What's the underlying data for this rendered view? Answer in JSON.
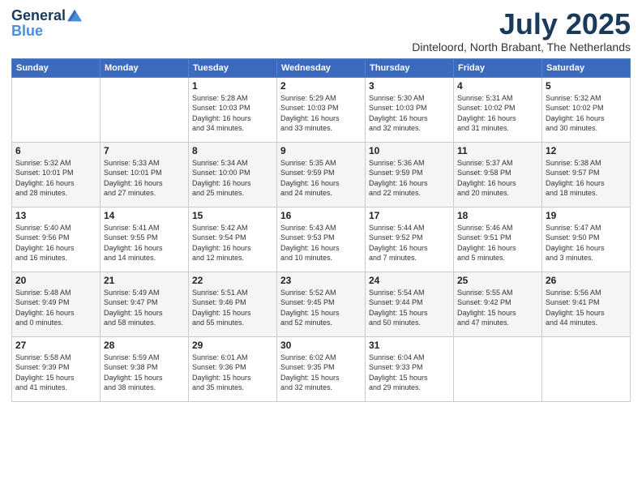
{
  "logo": {
    "line1": "General",
    "line2": "Blue"
  },
  "title": "July 2025",
  "subtitle": "Dinteloord, North Brabant, The Netherlands",
  "days_header": [
    "Sunday",
    "Monday",
    "Tuesday",
    "Wednesday",
    "Thursday",
    "Friday",
    "Saturday"
  ],
  "weeks": [
    [
      {
        "num": "",
        "info": ""
      },
      {
        "num": "",
        "info": ""
      },
      {
        "num": "1",
        "info": "Sunrise: 5:28 AM\nSunset: 10:03 PM\nDaylight: 16 hours\nand 34 minutes."
      },
      {
        "num": "2",
        "info": "Sunrise: 5:29 AM\nSunset: 10:03 PM\nDaylight: 16 hours\nand 33 minutes."
      },
      {
        "num": "3",
        "info": "Sunrise: 5:30 AM\nSunset: 10:03 PM\nDaylight: 16 hours\nand 32 minutes."
      },
      {
        "num": "4",
        "info": "Sunrise: 5:31 AM\nSunset: 10:02 PM\nDaylight: 16 hours\nand 31 minutes."
      },
      {
        "num": "5",
        "info": "Sunrise: 5:32 AM\nSunset: 10:02 PM\nDaylight: 16 hours\nand 30 minutes."
      }
    ],
    [
      {
        "num": "6",
        "info": "Sunrise: 5:32 AM\nSunset: 10:01 PM\nDaylight: 16 hours\nand 28 minutes."
      },
      {
        "num": "7",
        "info": "Sunrise: 5:33 AM\nSunset: 10:01 PM\nDaylight: 16 hours\nand 27 minutes."
      },
      {
        "num": "8",
        "info": "Sunrise: 5:34 AM\nSunset: 10:00 PM\nDaylight: 16 hours\nand 25 minutes."
      },
      {
        "num": "9",
        "info": "Sunrise: 5:35 AM\nSunset: 9:59 PM\nDaylight: 16 hours\nand 24 minutes."
      },
      {
        "num": "10",
        "info": "Sunrise: 5:36 AM\nSunset: 9:59 PM\nDaylight: 16 hours\nand 22 minutes."
      },
      {
        "num": "11",
        "info": "Sunrise: 5:37 AM\nSunset: 9:58 PM\nDaylight: 16 hours\nand 20 minutes."
      },
      {
        "num": "12",
        "info": "Sunrise: 5:38 AM\nSunset: 9:57 PM\nDaylight: 16 hours\nand 18 minutes."
      }
    ],
    [
      {
        "num": "13",
        "info": "Sunrise: 5:40 AM\nSunset: 9:56 PM\nDaylight: 16 hours\nand 16 minutes."
      },
      {
        "num": "14",
        "info": "Sunrise: 5:41 AM\nSunset: 9:55 PM\nDaylight: 16 hours\nand 14 minutes."
      },
      {
        "num": "15",
        "info": "Sunrise: 5:42 AM\nSunset: 9:54 PM\nDaylight: 16 hours\nand 12 minutes."
      },
      {
        "num": "16",
        "info": "Sunrise: 5:43 AM\nSunset: 9:53 PM\nDaylight: 16 hours\nand 10 minutes."
      },
      {
        "num": "17",
        "info": "Sunrise: 5:44 AM\nSunset: 9:52 PM\nDaylight: 16 hours\nand 7 minutes."
      },
      {
        "num": "18",
        "info": "Sunrise: 5:46 AM\nSunset: 9:51 PM\nDaylight: 16 hours\nand 5 minutes."
      },
      {
        "num": "19",
        "info": "Sunrise: 5:47 AM\nSunset: 9:50 PM\nDaylight: 16 hours\nand 3 minutes."
      }
    ],
    [
      {
        "num": "20",
        "info": "Sunrise: 5:48 AM\nSunset: 9:49 PM\nDaylight: 16 hours\nand 0 minutes."
      },
      {
        "num": "21",
        "info": "Sunrise: 5:49 AM\nSunset: 9:47 PM\nDaylight: 15 hours\nand 58 minutes."
      },
      {
        "num": "22",
        "info": "Sunrise: 5:51 AM\nSunset: 9:46 PM\nDaylight: 15 hours\nand 55 minutes."
      },
      {
        "num": "23",
        "info": "Sunrise: 5:52 AM\nSunset: 9:45 PM\nDaylight: 15 hours\nand 52 minutes."
      },
      {
        "num": "24",
        "info": "Sunrise: 5:54 AM\nSunset: 9:44 PM\nDaylight: 15 hours\nand 50 minutes."
      },
      {
        "num": "25",
        "info": "Sunrise: 5:55 AM\nSunset: 9:42 PM\nDaylight: 15 hours\nand 47 minutes."
      },
      {
        "num": "26",
        "info": "Sunrise: 5:56 AM\nSunset: 9:41 PM\nDaylight: 15 hours\nand 44 minutes."
      }
    ],
    [
      {
        "num": "27",
        "info": "Sunrise: 5:58 AM\nSunset: 9:39 PM\nDaylight: 15 hours\nand 41 minutes."
      },
      {
        "num": "28",
        "info": "Sunrise: 5:59 AM\nSunset: 9:38 PM\nDaylight: 15 hours\nand 38 minutes."
      },
      {
        "num": "29",
        "info": "Sunrise: 6:01 AM\nSunset: 9:36 PM\nDaylight: 15 hours\nand 35 minutes."
      },
      {
        "num": "30",
        "info": "Sunrise: 6:02 AM\nSunset: 9:35 PM\nDaylight: 15 hours\nand 32 minutes."
      },
      {
        "num": "31",
        "info": "Sunrise: 6:04 AM\nSunset: 9:33 PM\nDaylight: 15 hours\nand 29 minutes."
      },
      {
        "num": "",
        "info": ""
      },
      {
        "num": "",
        "info": ""
      }
    ]
  ]
}
